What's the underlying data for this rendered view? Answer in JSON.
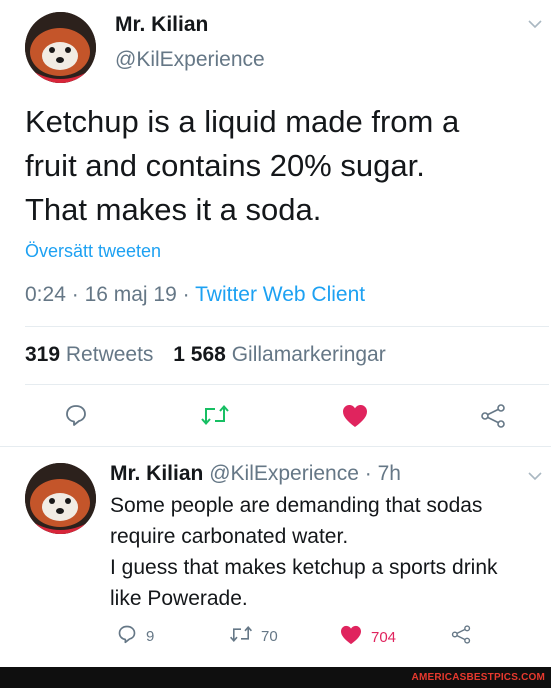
{
  "tweet": {
    "name": "Mr. Kilian",
    "handle": "@KilExperience",
    "text_lines": [
      "Ketchup is a liquid made from a",
      "fruit and contains 20% sugar.",
      "That makes it a soda."
    ],
    "translate_label": "Översätt tweeten",
    "time": "0:24",
    "date": "16 maj 19",
    "source": "Twitter Web Client",
    "separator": "·",
    "retweets_count": "319",
    "retweets_label": "Retweets",
    "likes_count": "1 568",
    "likes_label": "Gillamarkeringar"
  },
  "reply": {
    "name": "Mr. Kilian",
    "handle": "@KilExperience",
    "age": "7h",
    "separator": "·",
    "text_lines": [
      "Some people are demanding that sodas",
      "require carbonated water.",
      "I guess that makes ketchup a sports drink",
      "like Powerade."
    ],
    "reply_count": "9",
    "retweet_count": "70",
    "like_count": "704"
  },
  "watermark": "AMERICASBESTPICS.COM",
  "colors": {
    "accent": "#1da1f2",
    "retweet": "#17bf63",
    "like": "#e0245e",
    "muted": "#657786",
    "watermark": "#e8392e"
  },
  "icons": [
    "red-panda-avatar",
    "chevron-down-icon",
    "reply-icon",
    "retweet-icon",
    "heart-icon",
    "share-icon"
  ]
}
